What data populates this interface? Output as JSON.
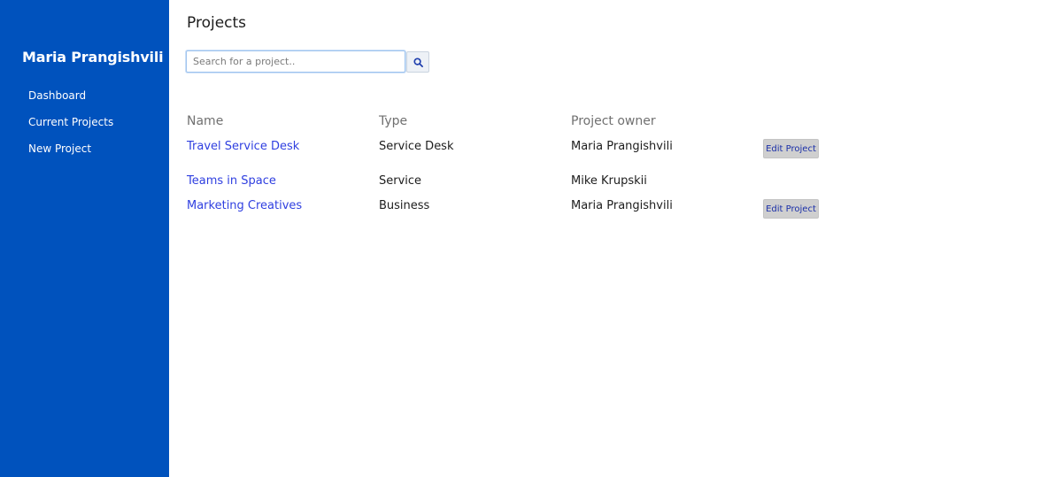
{
  "sidebar": {
    "user_name": "Maria Prangishvili",
    "items": [
      {
        "label": "Dashboard"
      },
      {
        "label": "Current Projects"
      },
      {
        "label": "New Project"
      }
    ]
  },
  "main": {
    "title": "Projects",
    "search": {
      "placeholder": "Search for a project..",
      "value": "",
      "button_icon": "search-icon"
    },
    "table": {
      "columns": [
        "Name",
        "Type",
        "Project owner"
      ],
      "rows": [
        {
          "name": "Travel Service Desk",
          "type": "Service Desk",
          "owner": "Maria Prangishvili",
          "action": "Edit Project"
        },
        {
          "name": "Teams in Space",
          "type": "Service",
          "owner": "Mike Krupskii",
          "action": null
        },
        {
          "name": "Marketing Creatives",
          "type": "Business",
          "owner": "Maria Prangishvili",
          "action": "Edit Project"
        }
      ]
    }
  },
  "colors": {
    "sidebar_bg": "#0052bd",
    "link": "#2f3fe0",
    "edit_button_bg": "#cfcfcf"
  }
}
